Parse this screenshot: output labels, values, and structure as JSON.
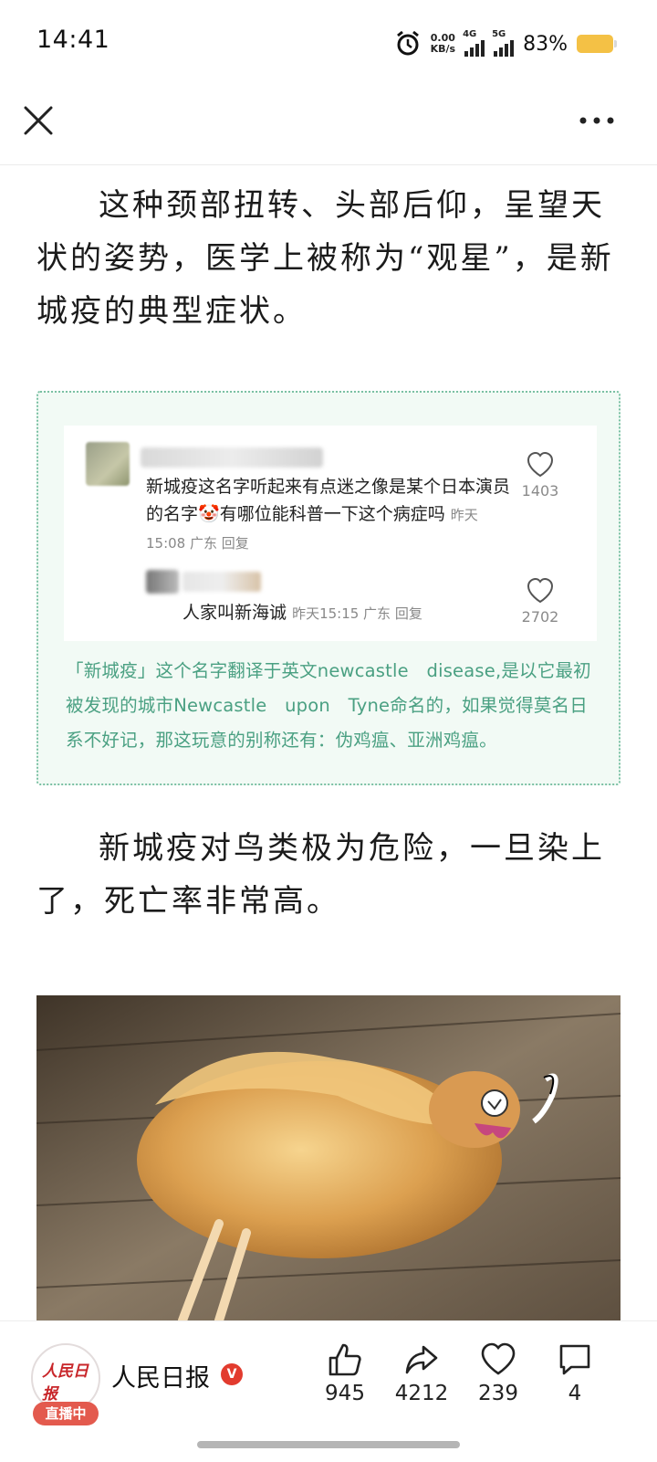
{
  "status_bar": {
    "time": "14:41",
    "net_speed_value": "0.00",
    "net_speed_unit": "KB/s",
    "signal1_label": "4G",
    "signal2_label": "5G",
    "battery_percent": "83%"
  },
  "nav": {
    "close_icon": "close-icon",
    "more_icon": "more-icon"
  },
  "article": {
    "paragraph1": "这种颈部扭转、头部后仰，呈望天状的姿势，医学上被称为“观星”，是新城疫的典型症状。",
    "comment": {
      "text": "新城疫这名字听起来有点迷之像是某个日本演员的名字",
      "emoji": "🤡",
      "text_after_emoji": "有哪位能科普一下这个病症吗",
      "meta": "昨天15:08 广东  回复",
      "likes": "1403"
    },
    "reply": {
      "text": "人家叫新海诚",
      "meta": "昨天15:15 广东  回复",
      "likes": "2702"
    },
    "note": "「新城疫」这个名字翻译于英文newcastle　disease,是以它最初被发现的城市Newcastle　upon　Tyne命名的，如果觉得莫名日系不好记，那这玩意的别称还有：伪鸡瘟、亚洲鸡瘟。",
    "paragraph2": "新城疫对鸟类极为危险，一旦染上了，死亡率非常高。"
  },
  "bottom_bar": {
    "publisher_logo_text": "人民日报",
    "live_badge": "直播中",
    "publisher_name": "人民日报",
    "verified_badge": "V",
    "actions": [
      {
        "icon": "thumbs-up-icon",
        "count": "945"
      },
      {
        "icon": "share-icon",
        "count": "4212"
      },
      {
        "icon": "heart-icon",
        "count": "239"
      },
      {
        "icon": "comment-icon",
        "count": "4"
      }
    ]
  },
  "colors": {
    "note_text": "#4aa082",
    "note_border": "#7ac0a3",
    "live_badge": "#e35a4e",
    "battery": "#f4c145"
  }
}
